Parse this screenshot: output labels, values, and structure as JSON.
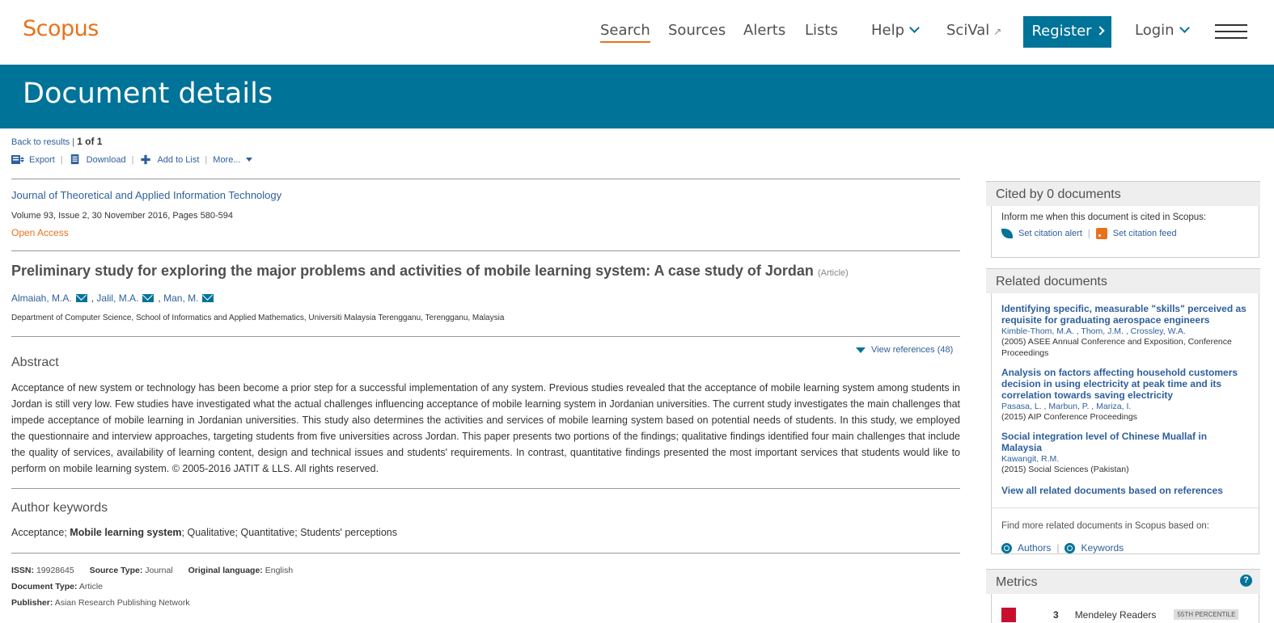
{
  "nav": {
    "logo": "Scopus",
    "search": "Search",
    "sources": "Sources",
    "alerts": "Alerts",
    "lists": "Lists",
    "help": "Help",
    "scival": "SciVal",
    "scival_ext": "↗",
    "register": "Register",
    "login": "Login"
  },
  "banner": {
    "title": "Document details"
  },
  "results": {
    "back": "Back to results",
    "separator": "|",
    "position": "1 of 1"
  },
  "toolbar": {
    "export": "Export",
    "download": "Download",
    "add_to_list": "Add to List",
    "more": "More..."
  },
  "doc": {
    "journal": "Journal of Theoretical and Applied Information Technology",
    "volume": "Volume 93, Issue 2, 30 November 2016, Pages 580-594",
    "open_access": "Open Access",
    "title": "Preliminary study for exploring the major problems and activities of mobile learning system: A case study of Jordan",
    "type": "(Article)",
    "authors": [
      "Almaiah, M.A.",
      "Jalil, M.A.",
      "Man, M."
    ],
    "author_sep": ",",
    "affiliation": "Department of Computer Science, School of Informatics and Applied Mathematics, Universiti Malaysia Terengganu, Terengganu, Malaysia",
    "view_refs": "View references (48)"
  },
  "abstract": {
    "heading": "Abstract",
    "text": "Acceptance of new system or technology has been become a prior step for a successful implementation of any system. Previous studies revealed that the acceptance of mobile learning system among students in Jordan is still very low. Few studies have investigated what the actual challenges influencing acceptance of mobile learning system in Jordanian universities. The current study investigates the main challenges that impede acceptance of mobile learning in Jordanian universities. This study also determines the activities and services of mobile learning system based on potential needs of students. In this study, we employed the questionnaire and interview approaches, targeting students from five universities across Jordan. This paper presents two portions of the findings; qualitative findings identified four main challenges that include the quality of services, availability of learning content, design and technical issues and students' requirements. In contrast, quantitative findings presented the most important services that students would like to perform on mobile learning system. © 2005-2016 JATIT & LLS. All rights reserved."
  },
  "keywords": {
    "heading": "Author keywords",
    "items": [
      "Acceptance",
      "Mobile learning system",
      "Qualitative",
      "Quantitative",
      "Students' perceptions"
    ]
  },
  "meta": {
    "issn_label": "ISSN:",
    "issn": "19928645",
    "source_type_label": "Source Type:",
    "source_type": "Journal",
    "language_label": "Original language:",
    "language": "English",
    "doc_type_label": "Document Type:",
    "doc_type": "Article",
    "publisher_label": "Publisher:",
    "publisher": "Asian Research Publishing Network"
  },
  "cited_by": {
    "heading": "Cited by 0 documents",
    "inform": "Inform me when this document is cited in Scopus:",
    "set_alert": "Set citation alert",
    "set_feed": "Set citation feed"
  },
  "related": {
    "heading": "Related documents",
    "items": [
      {
        "title": "Identifying specific, measurable \"skills\" perceived as requisite for graduating aerospace engineers",
        "authors": "Kimble-Thom, M.A. , Thom, J.M. , Crossley, W.A.",
        "source": "(2005) ASEE Annual Conference and Exposition, Conference Proceedings"
      },
      {
        "title": "Analysis on factors affecting household customers decision in using electricity at peak time and its correlation towards saving electricity",
        "authors": "Pasasa, L. , Marbun, P. , Mariza, I.",
        "source": "(2015) AIP Conference Proceedings"
      },
      {
        "title": "Social integration level of Chinese Muallaf in Malaysia",
        "authors": "Kawangit, R.M.",
        "source": "(2015) Social Sciences (Pakistan)"
      }
    ],
    "view_all": "View all related documents based on references",
    "find_more": "Find more related documents in Scopus based on:",
    "authors_link": "Authors",
    "keywords_link": "Keywords"
  },
  "metrics": {
    "heading": "Metrics",
    "help": "?",
    "mendeley_count": "3",
    "mendeley_label": "Mendeley Readers",
    "percentile": "55TH PERCENTILE"
  }
}
